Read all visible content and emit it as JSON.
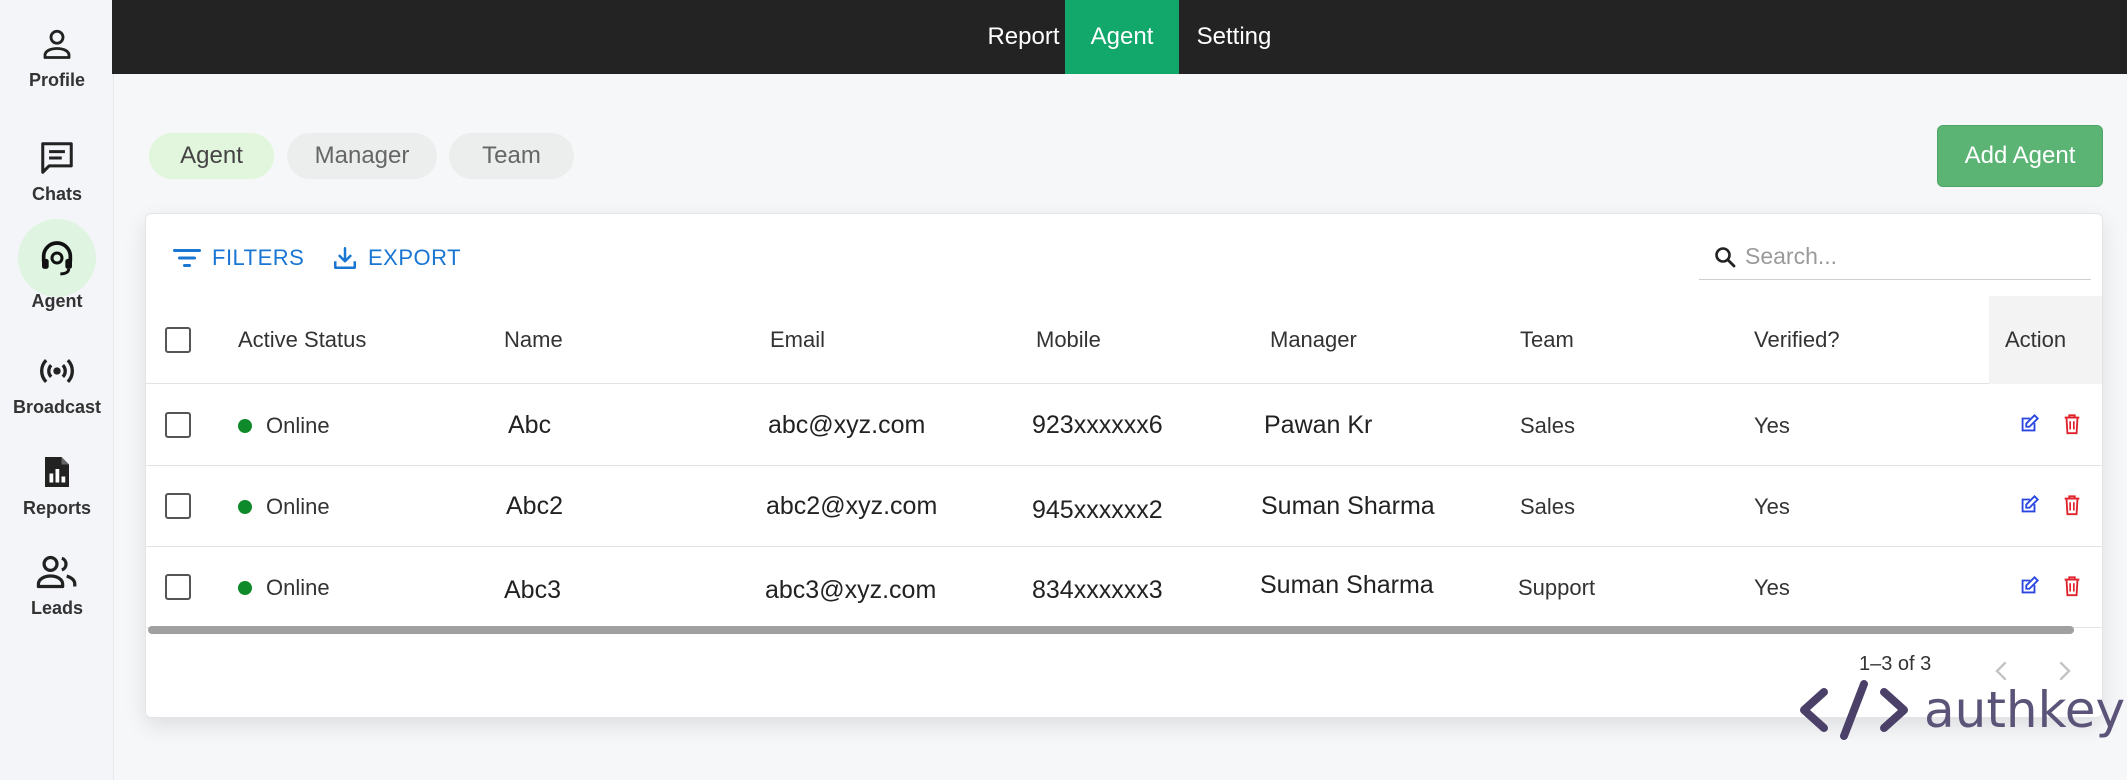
{
  "sidebar": {
    "items": [
      {
        "label": "Profile",
        "icon": "person-icon"
      },
      {
        "label": "Chats",
        "icon": "chat-icon"
      },
      {
        "label": "Agent",
        "icon": "headset-icon",
        "active": true
      },
      {
        "label": "Broadcast",
        "icon": "broadcast-icon"
      },
      {
        "label": "Reports",
        "icon": "report-icon"
      },
      {
        "label": "Leads",
        "icon": "people-icon"
      }
    ]
  },
  "topnav": {
    "tabs": [
      {
        "label": "Report"
      },
      {
        "label": "Agent",
        "active": true
      },
      {
        "label": "Setting"
      }
    ]
  },
  "subtabs": [
    {
      "label": "Agent",
      "active": true
    },
    {
      "label": "Manager"
    },
    {
      "label": "Team"
    }
  ],
  "add_button": "Add Agent",
  "toolbar": {
    "filters": "FILTERS",
    "export": "EXPORT",
    "search_placeholder": "Search..."
  },
  "table": {
    "columns": [
      "Active Status",
      "Name",
      "Email",
      "Mobile",
      "Manager",
      "Team",
      "Verified?",
      "Action"
    ],
    "rows": [
      {
        "status": "Online",
        "name": "Abc",
        "email": "abc@xyz.com",
        "mobile": "923xxxxxx6",
        "manager": "Pawan Kr",
        "team": "Sales",
        "verified": "Yes"
      },
      {
        "status": "Online",
        "name": "Abc2",
        "email": "abc2@xyz.com",
        "mobile": "945xxxxxx2",
        "manager": "Suman Sharma",
        "team": "Sales",
        "verified": "Yes"
      },
      {
        "status": "Online",
        "name": "Abc3",
        "email": "abc3@xyz.com",
        "mobile": "834xxxxxx3",
        "manager": "Suman Sharma",
        "team": "Support",
        "verified": "Yes"
      }
    ]
  },
  "pagination": {
    "info": "1–3 of 3"
  },
  "logo": {
    "text": "authkey"
  },
  "colors": {
    "accent": "#12a86b",
    "add_button": "#5bb473",
    "link": "#1976d2",
    "online": "#0f8a2a",
    "edit": "#2946e0",
    "delete": "#e0202a",
    "topnav": "#232323"
  }
}
